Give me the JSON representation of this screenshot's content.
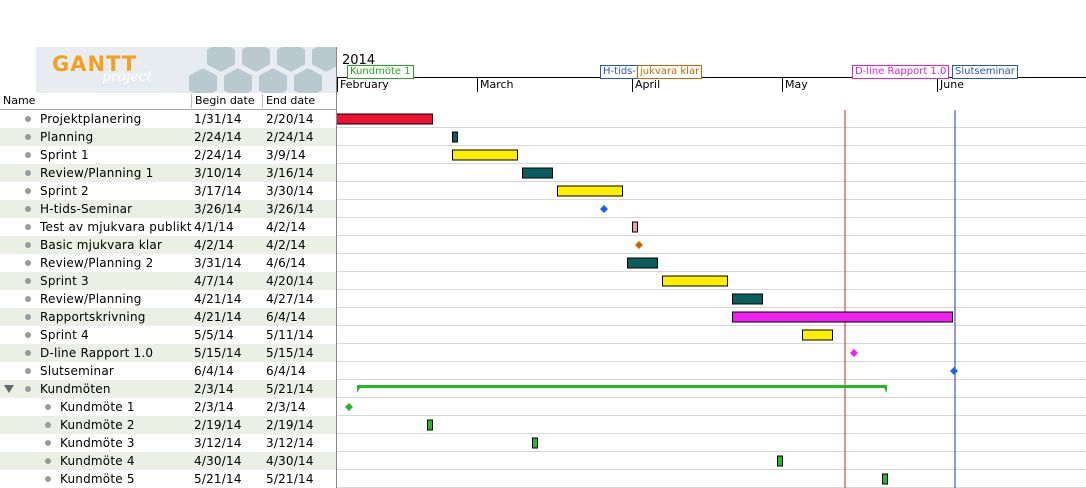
{
  "logo": {
    "main": "GANTT",
    "sub": "project"
  },
  "columns": {
    "name": "Name",
    "begin": "Begin date",
    "end": "End date"
  },
  "year": "2014",
  "months": [
    "February",
    "March",
    "April",
    "May",
    "June"
  ],
  "timeline_milestones": [
    {
      "label": "Kundmöte 1",
      "color": "#22aa22"
    },
    {
      "label": "H-tids-Seminar",
      "color": "#2255cc"
    },
    {
      "label": "jukvara klar",
      "color": "#cc6600"
    },
    {
      "label": "D-line Rapport 1.0",
      "color": "#dd22dd"
    },
    {
      "label": "Slutseminar",
      "color": "#2255cc"
    }
  ],
  "tasks": [
    {
      "name": "Projektplanering",
      "begin": "1/31/14",
      "end": "2/20/14",
      "kind": "bar",
      "color": "#ee1133"
    },
    {
      "name": "Planning",
      "begin": "2/24/14",
      "end": "2/24/14",
      "kind": "bar",
      "color": "#0b5e5e"
    },
    {
      "name": "Sprint 1",
      "begin": "2/24/14",
      "end": "3/9/14",
      "kind": "bar",
      "color": "#ffee00"
    },
    {
      "name": "Review/Planning 1",
      "begin": "3/10/14",
      "end": "3/16/14",
      "kind": "bar",
      "color": "#0b5e5e"
    },
    {
      "name": "Sprint 2",
      "begin": "3/17/14",
      "end": "3/30/14",
      "kind": "bar",
      "color": "#ffee00"
    },
    {
      "name": "H-tids-Seminar",
      "begin": "3/26/14",
      "end": "3/26/14",
      "kind": "milestone",
      "color": "#1166ee"
    },
    {
      "name": "Test av mjukvara publikt",
      "begin": "4/1/14",
      "end": "4/2/14",
      "kind": "bar",
      "color": "#f4a0a0"
    },
    {
      "name": "Basic mjukvara klar",
      "begin": "4/2/14",
      "end": "4/2/14",
      "kind": "milestone",
      "color": "#cc6600"
    },
    {
      "name": "Review/Planning 2",
      "begin": "3/31/14",
      "end": "4/6/14",
      "kind": "bar",
      "color": "#0b5e5e"
    },
    {
      "name": "Sprint 3",
      "begin": "4/7/14",
      "end": "4/20/14",
      "kind": "bar",
      "color": "#ffee00"
    },
    {
      "name": "Review/Planning",
      "begin": "4/21/14",
      "end": "4/27/14",
      "kind": "bar",
      "color": "#0b5e5e"
    },
    {
      "name": "Rapportskrivning",
      "begin": "4/21/14",
      "end": "6/4/14",
      "kind": "bar",
      "color": "#ee22ee"
    },
    {
      "name": "Sprint 4",
      "begin": "5/5/14",
      "end": "5/11/14",
      "kind": "bar",
      "color": "#ffee00"
    },
    {
      "name": "D-line Rapport 1.0",
      "begin": "5/15/14",
      "end": "5/15/14",
      "kind": "milestone",
      "color": "#ee22ee"
    },
    {
      "name": "Slutseminar",
      "begin": "6/4/14",
      "end": "6/4/14",
      "kind": "milestone",
      "color": "#1166ee"
    },
    {
      "name": "Kundmöten",
      "begin": "2/3/14",
      "end": "5/21/14",
      "kind": "summary",
      "color": "#22bb22"
    },
    {
      "name": "Kundmöte 1",
      "begin": "2/3/14",
      "end": "2/3/14",
      "kind": "milestone",
      "color": "#22bb22",
      "child": true
    },
    {
      "name": "Kundmöte 2",
      "begin": "2/19/14",
      "end": "2/19/14",
      "kind": "bar",
      "color": "#22bb22",
      "child": true
    },
    {
      "name": "Kundmöte 3",
      "begin": "3/12/14",
      "end": "3/12/14",
      "kind": "bar",
      "color": "#22bb22",
      "child": true
    },
    {
      "name": "Kundmöte 4",
      "begin": "4/30/14",
      "end": "4/30/14",
      "kind": "bar",
      "color": "#22bb22",
      "child": true
    },
    {
      "name": "Kundmöte 5",
      "begin": "5/21/14",
      "end": "5/21/14",
      "kind": "bar",
      "color": "#22bb22",
      "child": true
    }
  ],
  "colors": {
    "deadline_red": "#cc2222",
    "deadline_blue": "#2233cc",
    "row_alt": "#ecefe3"
  }
}
